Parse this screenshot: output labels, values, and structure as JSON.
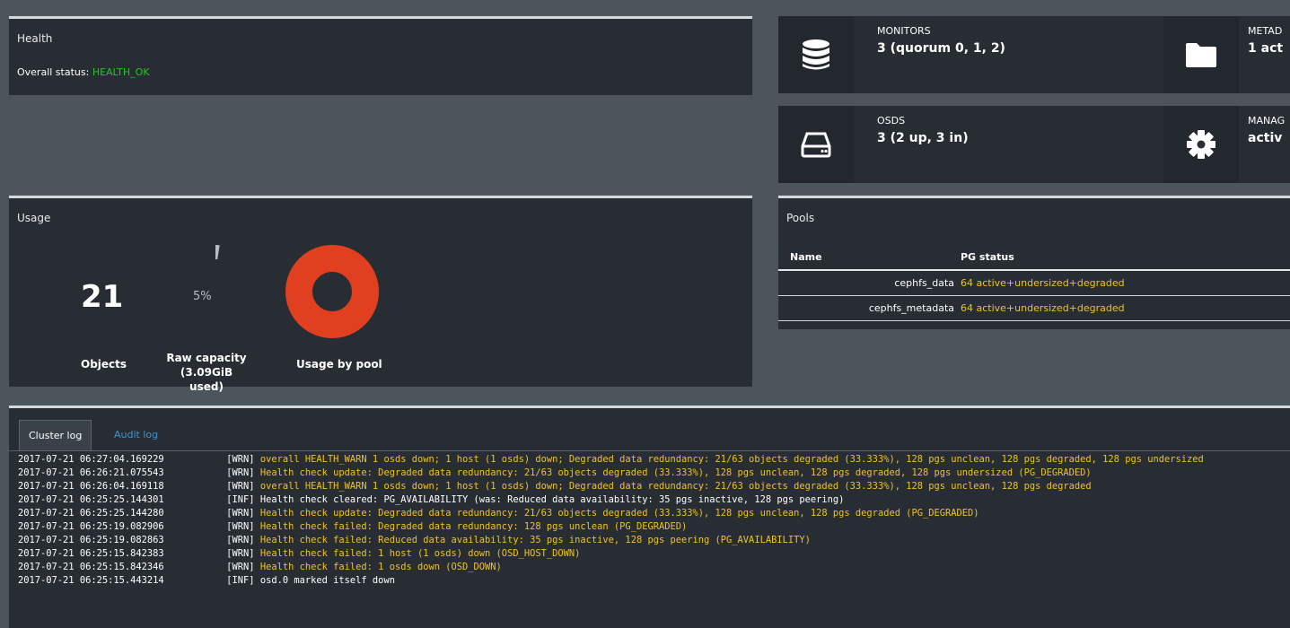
{
  "health": {
    "title": "Health",
    "overall_label": "Overall status: ",
    "overall_value": "HEALTH_OK"
  },
  "tiles": {
    "monitors": {
      "label": "MONITORS",
      "value": "3 (quorum 0, 1, 2)",
      "icon": "database-icon"
    },
    "metadata": {
      "label": "METAD",
      "value": "1 act",
      "icon": "folder-icon"
    },
    "osds": {
      "label": "OSDS",
      "value": "3 (2 up, 3 in)",
      "icon": "hard-drive-icon"
    },
    "managers": {
      "label": "MANAG",
      "value": "activ",
      "icon": "gear-icon"
    }
  },
  "usage": {
    "title": "Usage",
    "objects_value": "21",
    "objects_label": "Objects",
    "raw_pct_text": "5%",
    "raw_pct": 0.05,
    "raw_label_line1": "Raw capacity",
    "raw_label_line2": "(3.09GiB used)",
    "pool_label": "Usage by pool"
  },
  "pools": {
    "title": "Pools",
    "columns": [
      "Name",
      "PG status"
    ],
    "rows": [
      {
        "name": "cephfs_data",
        "status": "64 active+undersized+degraded"
      },
      {
        "name": "cephfs_metadata",
        "status": "64 active+undersized+degraded"
      }
    ]
  },
  "log": {
    "tabs": [
      "Cluster log",
      "Audit log"
    ],
    "entries": [
      {
        "ts": "2017-07-21 06:27:04.169229",
        "pr": "[WRN]",
        "msg": "overall HEALTH_WARN 1 osds down; 1 host (1 osds) down; Degraded data redundancy: 21/63 objects degraded (33.333%), 128 pgs unclean, 128 pgs degraded, 128 pgs undersized"
      },
      {
        "ts": "2017-07-21 06:26:21.075543",
        "pr": "[WRN]",
        "msg": "Health check update: Degraded data redundancy: 21/63 objects degraded (33.333%), 128 pgs unclean, 128 pgs degraded, 128 pgs undersized (PG_DEGRADED)"
      },
      {
        "ts": "2017-07-21 06:26:04.169118",
        "pr": "[WRN]",
        "msg": "overall HEALTH_WARN 1 osds down; 1 host (1 osds) down; Degraded data redundancy: 21/63 objects degraded (33.333%), 128 pgs unclean, 128 pgs degraded"
      },
      {
        "ts": "2017-07-21 06:25:25.144301",
        "pr": "[INF]",
        "msg": "Health check cleared: PG_AVAILABILITY (was: Reduced data availability: 35 pgs inactive, 128 pgs peering)"
      },
      {
        "ts": "2017-07-21 06:25:25.144280",
        "pr": "[WRN]",
        "msg": "Health check update: Degraded data redundancy: 21/63 objects degraded (33.333%), 128 pgs unclean, 128 pgs degraded (PG_DEGRADED)"
      },
      {
        "ts": "2017-07-21 06:25:19.082906",
        "pr": "[WRN]",
        "msg": "Health check failed: Degraded data redundancy: 128 pgs unclean (PG_DEGRADED)"
      },
      {
        "ts": "2017-07-21 06:25:19.082863",
        "pr": "[WRN]",
        "msg": "Health check failed: Reduced data availability: 35 pgs inactive, 128 pgs peering (PG_AVAILABILITY)"
      },
      {
        "ts": "2017-07-21 06:25:15.842383",
        "pr": "[WRN]",
        "msg": "Health check failed: 1 host (1 osds) down (OSD_HOST_DOWN)"
      },
      {
        "ts": "2017-07-21 06:25:15.842346",
        "pr": "[WRN]",
        "msg": "Health check failed: 1 osds down (OSD_DOWN)"
      },
      {
        "ts": "2017-07-21 06:25:15.443214",
        "pr": "[INF]",
        "msg": "osd.0 marked itself down"
      }
    ]
  },
  "colors": {
    "ok": "#21c521",
    "warn": "#f0c419",
    "donut": "#e0401f",
    "link": "#3b95d7"
  }
}
